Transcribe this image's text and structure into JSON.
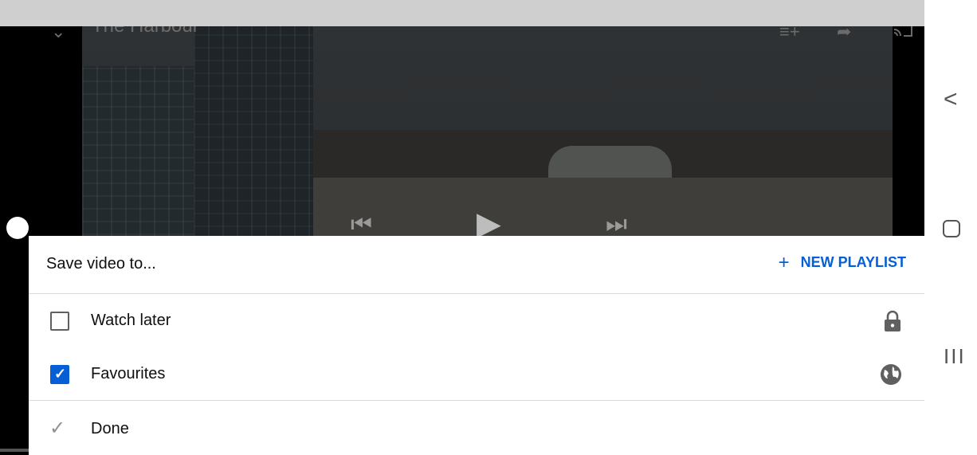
{
  "player": {
    "title": "The Harbour",
    "icons": {
      "collapse": "chevron-down-icon",
      "add_to_queue": "add-to-queue-icon",
      "share": "share-icon",
      "cast": "cast-icon",
      "previous": "skip-previous-icon",
      "play": "play-icon",
      "next": "skip-next-icon"
    }
  },
  "sheet": {
    "title": "Save video to...",
    "new_playlist_label": "NEW PLAYLIST",
    "playlists": [
      {
        "label": "Watch later",
        "checked": false,
        "privacy_icon": "lock-icon"
      },
      {
        "label": "Favourites",
        "checked": true,
        "privacy_icon": "globe-icon"
      }
    ],
    "done_label": "Done"
  },
  "navbar": {
    "back_icon": "back-icon",
    "home_icon": "home-icon",
    "recents_icon": "recents-icon"
  },
  "colors": {
    "accent": "#065fd4",
    "text": "#0f0f0f",
    "divider": "#d9d9d9",
    "icon_gray": "#606060"
  }
}
